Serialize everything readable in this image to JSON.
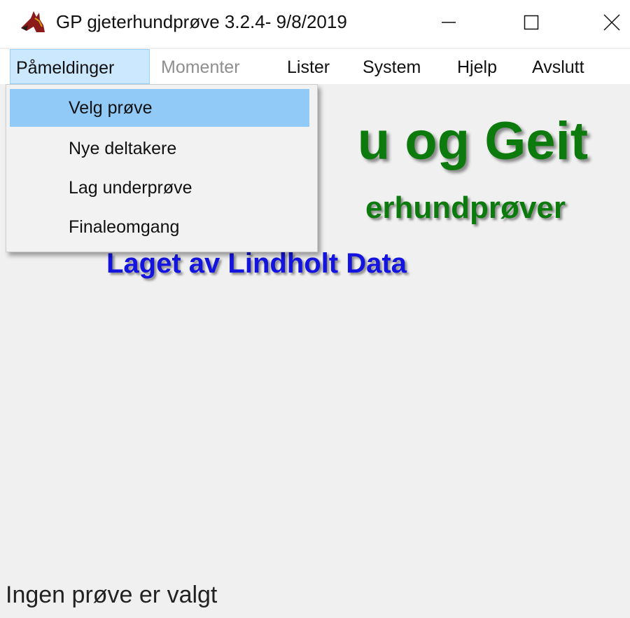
{
  "window": {
    "title": "GP gjeterhundprøve 3.2.4- 9/8/2019",
    "app_icon": "horse-head-icon",
    "controls": {
      "minimize_icon": "minimize-icon",
      "maximize_icon": "maximize-icon",
      "close_icon": "close-icon"
    }
  },
  "menubar": {
    "items": [
      {
        "label": "Påmeldinger",
        "state": "active"
      },
      {
        "label": "Momenter",
        "state": "disabled"
      },
      {
        "label": "Lister",
        "state": "normal"
      },
      {
        "label": "System",
        "state": "normal"
      },
      {
        "label": "Hjelp",
        "state": "normal"
      },
      {
        "label": "Avslutt",
        "state": "normal"
      }
    ]
  },
  "dropdown": {
    "items": [
      {
        "label": "Velg prøve",
        "highlighted": true
      },
      {
        "label": "Nye deltakere",
        "highlighted": false
      },
      {
        "label": "Lag underprøve",
        "highlighted": false
      },
      {
        "label": "Finaleomgang",
        "highlighted": false
      }
    ]
  },
  "splash": {
    "line1": "u og Geit",
    "line2": "erhundprøver",
    "line3": "Laget av Lindholt Data"
  },
  "status": {
    "text": "Ingen prøve er valgt"
  },
  "colors": {
    "green_text": "#0d7a0d",
    "blue_text": "#1414e0",
    "highlight": "#91c9f7",
    "menu_active": "#cce8ff"
  }
}
